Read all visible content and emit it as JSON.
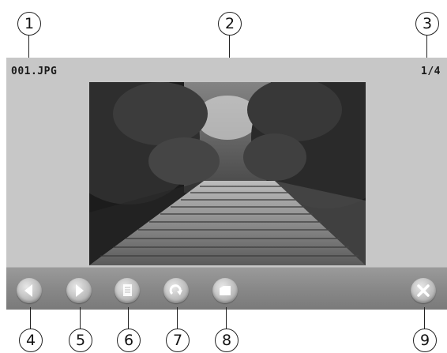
{
  "viewer": {
    "filename": "001.JPG",
    "page_indicator": "1/4"
  },
  "callouts": [
    "1",
    "2",
    "3",
    "4",
    "5",
    "6",
    "7",
    "8",
    "9"
  ],
  "toolbar": {
    "buttons": [
      {
        "name": "previous-button",
        "icon": "triangle-left-icon"
      },
      {
        "name": "next-button",
        "icon": "triangle-right-icon"
      },
      {
        "name": "slideshow-button",
        "icon": "document-icon"
      },
      {
        "name": "rotate-button",
        "icon": "rotate-arrow-icon"
      },
      {
        "name": "folder-button",
        "icon": "folder-icon"
      },
      {
        "name": "close-button",
        "icon": "close-x-icon"
      }
    ]
  },
  "colors": {
    "screen_bg": "#c7c7c7",
    "toolbar_bg": "#8a8a8a",
    "button_face": "#c4c4c4",
    "text": "#1a1a1a"
  }
}
